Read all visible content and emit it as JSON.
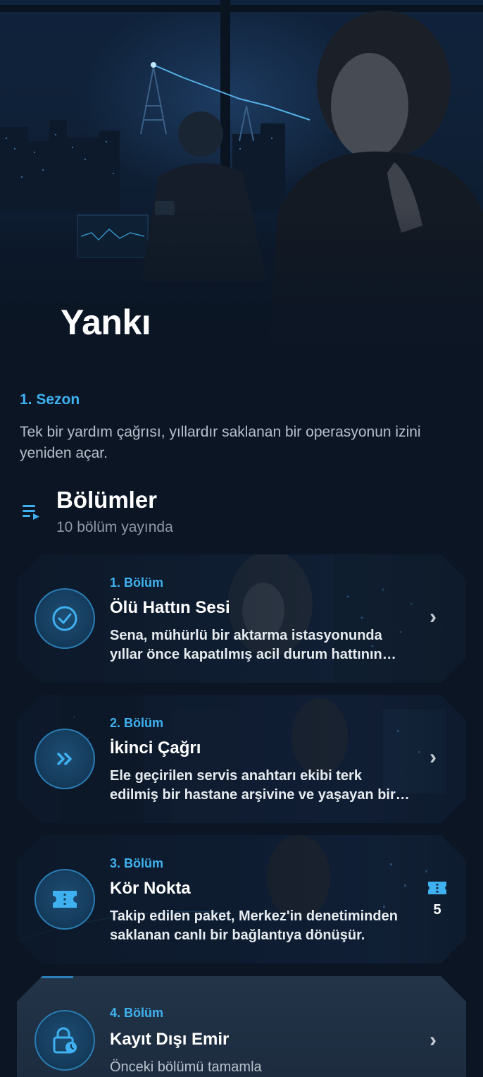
{
  "show": {
    "title": "Yankı",
    "season": "1. Sezon",
    "synopsis": "Tek bir yardım çağrısı, yıllardır saklanan bir operasyonun izini yeniden açar."
  },
  "episodes_section": {
    "title": "Bölümler",
    "subtitle": "10 bölüm yayında",
    "icon": "playlist-icon"
  },
  "colors": {
    "accent": "#3fb1f0",
    "background": "#0b1524",
    "card": "#13233a"
  },
  "episodes": [
    {
      "number": "1. Bölüm",
      "title": "Ölü Hattın Sesi",
      "description": "Sena, mühürlü bir aktarma istasyonunda yıllar önce kapatılmış acil durum hattının yeniden çalıştığını fark eder.",
      "icon": "check-circle-icon",
      "status": "completed"
    },
    {
      "number": "2. Bölüm",
      "title": "İkinci Çağrı",
      "description": "Ele geçirilen servis anahtarı ekibi terk edilmiş bir hastane arşivine ve yaşayan bir tanığa götürür.",
      "icon": "double-chevron-icon",
      "status": "in-progress"
    },
    {
      "number": "3. Bölüm",
      "title": "Kör Nokta",
      "description": "Takip edilen paket, Merkez'in denetiminden saklanan canlı bir bağlantıya dönüşür.",
      "icon": "ticket-icon",
      "status": "ticket",
      "badge_icon": "ticket-icon",
      "badge_count": "5"
    },
    {
      "number": "4. Bölüm",
      "title": "Kayıt Dışı Emir",
      "description": "Önceki bölümü tamamla",
      "icon": "lock-clock-icon",
      "status": "locked"
    }
  ]
}
